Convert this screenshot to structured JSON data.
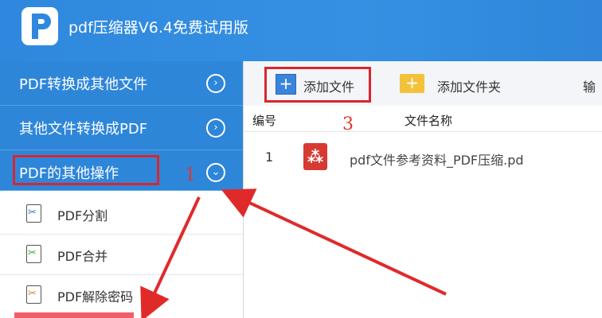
{
  "app": {
    "title": "pdf压缩器V6.4免费试用版"
  },
  "sidebar": {
    "groups": [
      {
        "label": "PDF转换成其他文件",
        "icon": "chevron-right-circle-icon"
      },
      {
        "label": "其他文件转换成PDF",
        "icon": "chevron-right-circle-icon"
      },
      {
        "label": "PDF的其他操作",
        "icon": "chevron-down-circle-icon"
      }
    ],
    "items": [
      {
        "label": "PDF分割",
        "icon": "pdf-split-icon",
        "color": "#3b74c7"
      },
      {
        "label": "PDF合并",
        "icon": "pdf-merge-icon",
        "color": "#3ea24a"
      },
      {
        "label": "PDF解除密码",
        "icon": "pdf-unlock-icon",
        "color": "#c9862a"
      }
    ]
  },
  "toolbar": {
    "add_file_label": "添加文件",
    "add_folder_label": "添加文件夹",
    "more_label": "输"
  },
  "table": {
    "headers": [
      "编号",
      "文件名称"
    ],
    "rows": [
      {
        "num": "1",
        "filename": "pdf文件参考资料_PDF压缩.pd"
      }
    ]
  },
  "annotations": {
    "step1": "1",
    "step3": "3"
  },
  "colors": {
    "titlebar": "#2f88dd",
    "sidebar_group": "#2e86d9",
    "annotation_red": "#d8262f",
    "pdf_red": "#d73a32"
  }
}
